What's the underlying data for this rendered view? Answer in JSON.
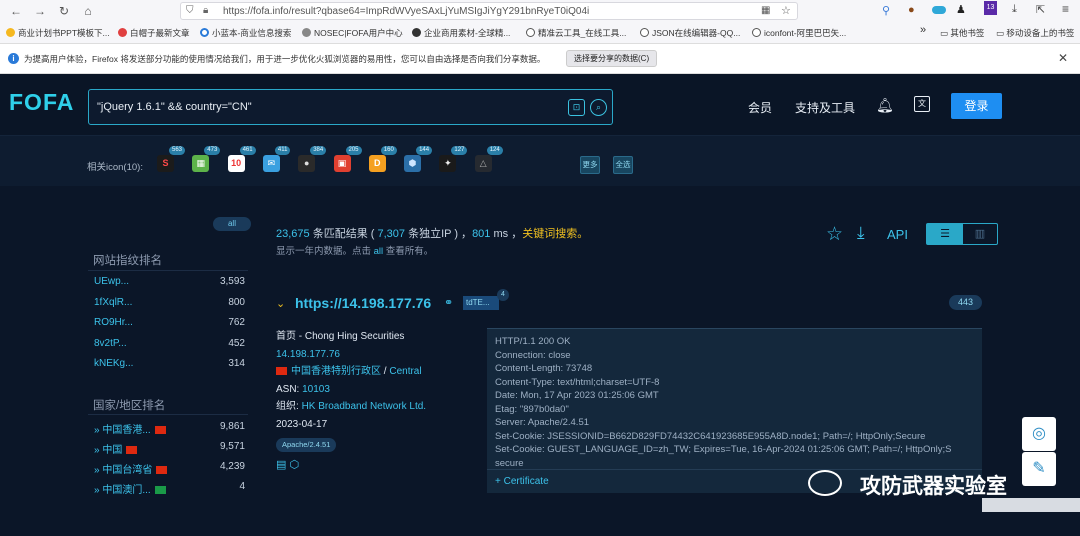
{
  "browser": {
    "url": "https://fofa.info/result?qbase64=ImpRdWVyeSAxLjYuMSIgJiYgY291bnRyeT0iQ04i",
    "bookmarks": [
      "商业计划书PPT模板下...",
      "白帽子最新文章",
      "小蓝本-商业信息搜索",
      "NOSEC|FOFA用户中心",
      "企业商用素材-全球精...",
      "精准云工具_在线工具...",
      "JSON在线编辑器-QQ...",
      "iconfont-阿里巴巴矢...",
      "其他书签",
      "移动设备上的书签"
    ],
    "notice": "为提高用户体验，Firefox 将发送部分功能的使用情况给我们，用于进一步优化火狐浏览器的易用性，您可以自由选择是否向我们分享数据。",
    "notice_button": "选择要分享的数据(C)",
    "profile_badge": "13"
  },
  "header": {
    "logo": "FOFA",
    "query": "\"jQuery 1.6.1\" && country=\"CN\"",
    "nav": [
      "会员",
      "支持及工具"
    ],
    "login": "登录"
  },
  "related": {
    "label": "相关icon(10):",
    "items": [
      {
        "count": "563",
        "glyph": "S",
        "bg": "#1b1b1b",
        "fg": "#ff4a4a"
      },
      {
        "count": "473",
        "glyph": "▦",
        "bg": "#5db34a",
        "fg": "#fff"
      },
      {
        "count": "461",
        "glyph": "10",
        "bg": "#ffffff",
        "fg": "#e33"
      },
      {
        "count": "411",
        "glyph": "✉",
        "bg": "#3aa0e0",
        "fg": "#fff"
      },
      {
        "count": "384",
        "glyph": "●",
        "bg": "#2a2a2a",
        "fg": "#ddd"
      },
      {
        "count": "205",
        "glyph": "▣",
        "bg": "#e04030",
        "fg": "#fff"
      },
      {
        "count": "160",
        "glyph": "D",
        "bg": "#f5a020",
        "fg": "#fff"
      },
      {
        "count": "144",
        "glyph": "⬢",
        "bg": "#2b6fa8",
        "fg": "#cfe6ff"
      },
      {
        "count": "127",
        "glyph": "✦",
        "bg": "#1a1a1a",
        "fg": "#eee"
      },
      {
        "count": "124",
        "glyph": "△",
        "bg": "#262a30",
        "fg": "#aaa"
      }
    ],
    "more": "更多",
    "select_all": "全选"
  },
  "sidebar": {
    "all_tag": "all",
    "fp_title": "网站指纹排名",
    "fingerprints": [
      {
        "name": "UEwp...",
        "count": "3,593"
      },
      {
        "name": "1fXqlR...",
        "count": "800"
      },
      {
        "name": "RO9Hr...",
        "count": "762"
      },
      {
        "name": "8v2tP...",
        "count": "452"
      },
      {
        "name": "kNEKg...",
        "count": "314"
      }
    ],
    "country_title": "国家/地区排名",
    "countries": [
      {
        "name": "中国香港...",
        "count": "9,861",
        "flag": "#de2910"
      },
      {
        "name": "中国",
        "count": "9,571",
        "flag": "#de2910"
      },
      {
        "name": "中国台湾省",
        "count": "4,239",
        "flag": "#de2910"
      },
      {
        "name": "中国澳门...",
        "count": "4",
        "flag": "#1a9a48"
      }
    ]
  },
  "summary": {
    "total": "23,675",
    "t1": " 条匹配结果 ( ",
    "unique": "7,307",
    "t2": " 条独立IP ) ，",
    "ms": "801",
    "t3": " ms ，",
    "keyword": "关键词搜索。",
    "sub1": "显示一年内数据。点击 ",
    "sub_all": "all",
    "sub2": " 查看所有。"
  },
  "tools": {
    "api": "API"
  },
  "result": {
    "url": "https://14.198.177.76",
    "tag": "tdTE...",
    "tag_count": "4",
    "port": "443",
    "title": "首页 - Chong Hing Securities",
    "ip": "14.198.177.76",
    "region": "中国香港特别行政区",
    "city": "Central",
    "asn_label": "ASN: ",
    "asn": "10103",
    "org_label": "组织: ",
    "org": "HK Broadband Network Ltd.",
    "date": "2023-04-17",
    "server_tag": "Apache/2.4.51",
    "banner": "HTTP/1.1 200 OK\nConnection: close\nContent-Length: 73748\nContent-Type: text/html;charset=UTF-8\nDate: Mon, 17 Apr 2023 01:25:06 GMT\nEtag: \"897b0da0\"\nServer: Apache/2.4.51\nSet-Cookie: JSESSIONID=B662D829FD74432C641923685E955A8D.node1; Path=/; HttpOnly;Secure\nSet-Cookie: GUEST_LANGUAGE_ID=zh_TW; Expires=Tue, 16-Apr-2024 01:25:06 GMT; Path=/; HttpOnly;S\nsecure",
    "certificate": "+ Certificate"
  },
  "watermark": "攻防武器实验室"
}
